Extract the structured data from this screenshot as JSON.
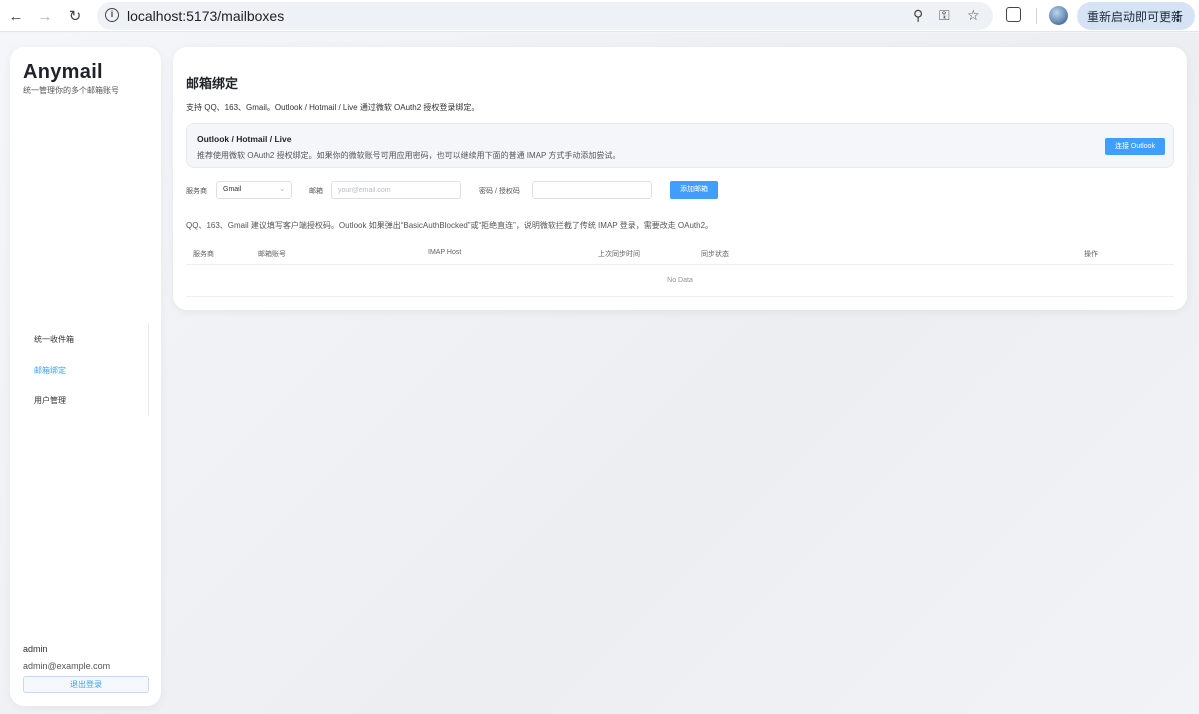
{
  "browser": {
    "url": "localhost:5173/mailboxes",
    "update_button": "重新启动即可更新"
  },
  "sidebar": {
    "brand": "Anymail",
    "subtitle": "统一管理你的多个邮箱账号",
    "items": [
      {
        "label": "统一收件箱",
        "active": false
      },
      {
        "label": "邮箱绑定",
        "active": true
      },
      {
        "label": "用户管理",
        "active": false
      }
    ],
    "user": {
      "name": "admin",
      "email": "admin@example.com"
    },
    "logout_label": "退出登录"
  },
  "main": {
    "title": "邮箱绑定",
    "intro": "支持 QQ、163、Gmail。Outlook / Hotmail / Live 通过微软 OAuth2 授权登录绑定。",
    "outlook": {
      "title": "Outlook / Hotmail / Live",
      "desc": "推荐使用微软 OAuth2 授权绑定。如果你的微软账号可用应用密码，也可以继续用下面的普通 IMAP 方式手动添加尝试。",
      "connect_label": "连接 Outlook"
    },
    "form": {
      "provider_label": "服务商",
      "provider_value": "Gmail",
      "email_label": "邮箱",
      "email_placeholder": "your@email.com",
      "password_label": "密码 / 授权码",
      "password_value": "",
      "add_label": "添加邮箱"
    },
    "hint": "QQ、163、Gmail 建议填写客户端授权码。Outlook 如果弹出“BasicAuthBlocked”或“拒绝直连”，说明微软拦截了传统 IMAP 登录，需要改走 OAuth2。",
    "table": {
      "columns": [
        "服务商",
        "邮箱账号",
        "IMAP Host",
        "上次同步时间",
        "同步状态",
        "操作"
      ],
      "rows": [],
      "empty_text": "No Data"
    }
  },
  "colors": {
    "accent": "#409eff",
    "update_bg": "#d6e3f5"
  }
}
